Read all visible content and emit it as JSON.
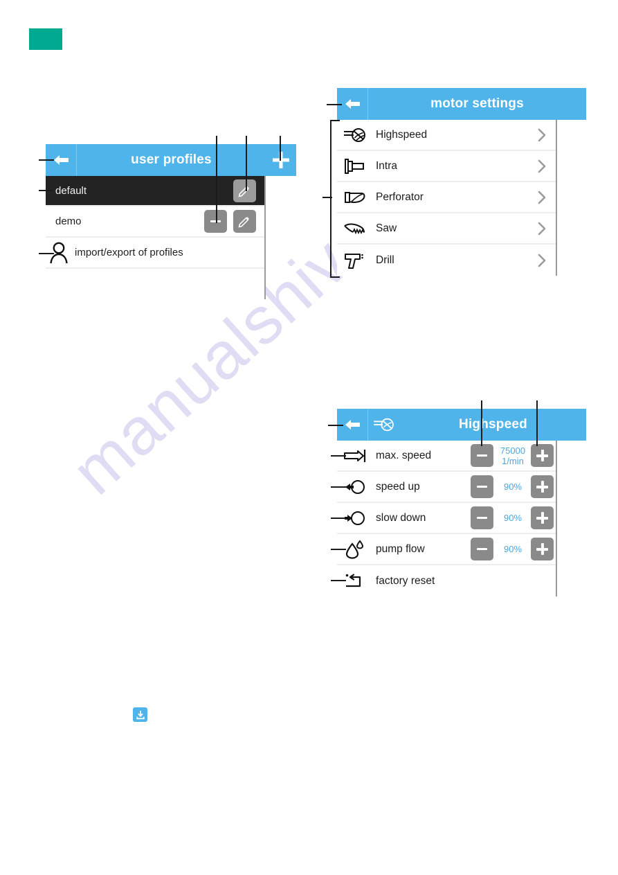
{
  "brand": {
    "chip_color": "#00a98f"
  },
  "watermark": {
    "text": "manualshive.com",
    "color": "#cdc8ee"
  },
  "theme": {
    "header_blue": "#4fb4e9",
    "value_blue": "#4aa7dd",
    "button_gray": "#8a8a8a",
    "dark_row": "#232323"
  },
  "panels": {
    "user_profiles": {
      "title": "user profiles",
      "back_icon": "back-arrow-icon",
      "add_icon": "plus-icon",
      "rows": [
        {
          "label": "default",
          "selected": true,
          "minus": false,
          "edit": true
        },
        {
          "label": "demo",
          "selected": false,
          "minus": true,
          "edit": true
        }
      ],
      "import_export": {
        "label": "import/export of profiles",
        "icon": "user-icon"
      }
    },
    "motor_settings": {
      "title": "motor settings",
      "back_icon": "back-arrow-icon",
      "rows": [
        {
          "label": "Highspeed",
          "icon": "highspeed-bur-icon",
          "chevron": "chevron-right-icon"
        },
        {
          "label": "Intra",
          "icon": "intra-handpiece-icon",
          "chevron": "chevron-right-icon"
        },
        {
          "label": "Perforator",
          "icon": "perforator-icon",
          "chevron": "chevron-right-icon"
        },
        {
          "label": "Saw",
          "icon": "saw-blade-icon",
          "chevron": "chevron-right-icon"
        },
        {
          "label": "Drill",
          "icon": "drill-icon",
          "chevron": "chevron-right-icon"
        }
      ]
    },
    "highspeed": {
      "title": "Highspeed",
      "back_icon": "back-arrow-icon",
      "header_icon": "highspeed-bur-icon",
      "rows": [
        {
          "label": "max. speed",
          "icon": "max-speed-icon",
          "minus": "−",
          "plus": "+",
          "value": "75000",
          "unit": "1/min"
        },
        {
          "label": "speed up",
          "icon": "speed-up-icon",
          "minus": "−",
          "plus": "+",
          "value": "90%",
          "unit": ""
        },
        {
          "label": "slow down",
          "icon": "slow-down-icon",
          "minus": "−",
          "plus": "+",
          "value": "90%",
          "unit": ""
        },
        {
          "label": "pump flow",
          "icon": "pump-flow-drop-icon",
          "minus": "−",
          "plus": "+",
          "value": "90%",
          "unit": ""
        },
        {
          "label": "factory reset",
          "icon": "factory-reset-icon",
          "minus": "",
          "plus": "",
          "value": "",
          "unit": ""
        }
      ]
    }
  },
  "footer": {
    "download_icon": "download-icon"
  }
}
